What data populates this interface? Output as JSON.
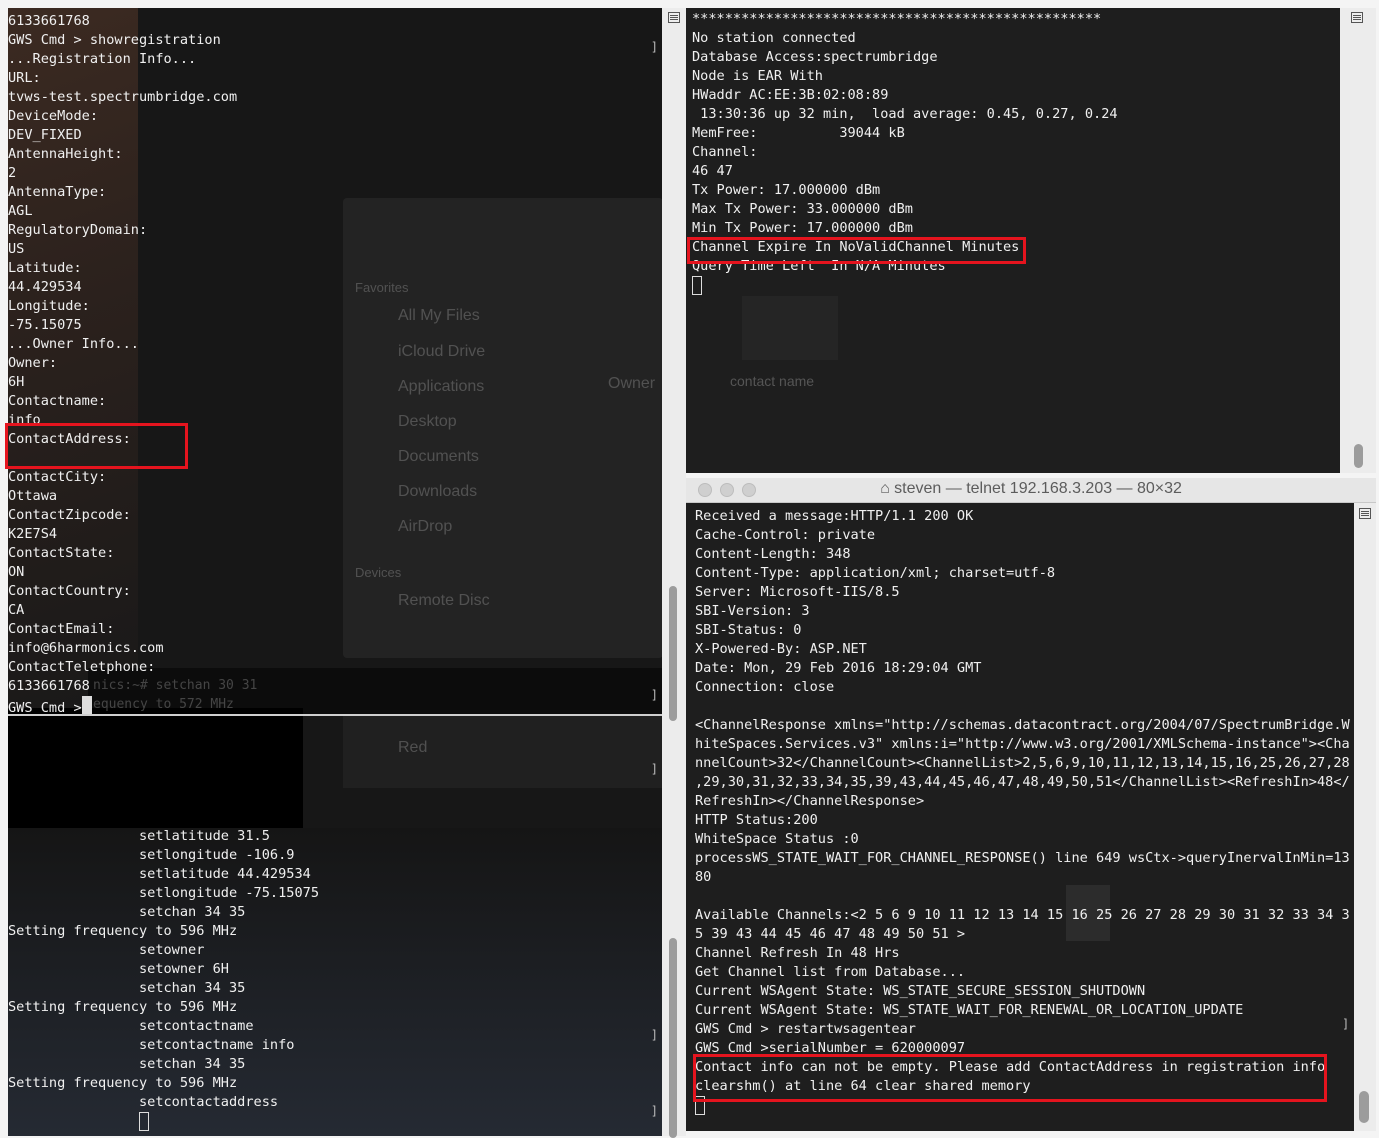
{
  "left_terminal": {
    "lines": [
      "6133661768",
      "GWS Cmd > showregistration",
      "...Registration Info...",
      "URL:",
      "tvws-test.spectrumbridge.com",
      "DeviceMode:",
      "DEV_FIXED",
      "AntennaHeight:",
      "2",
      "AntennaType:",
      "AGL",
      "RegulatoryDomain:",
      "US",
      "Latitude:",
      "44.429534",
      "Longitude:",
      "-75.15075",
      "...Owner Info...",
      "Owner:",
      "6H",
      "Contactname:",
      "info",
      "ContactAddress:",
      "",
      "ContactCity:",
      "Ottawa",
      "ContactZipcode:",
      "K2E7S4",
      "ContactState:",
      "ON",
      "ContactCountry:",
      "CA",
      "ContactEmail:",
      "info@6harmonics.com",
      "ContactTeletphone:",
      "6133661768",
      "GWS Cmd >"
    ],
    "ghost_text": {
      "favorites": "Favorites",
      "all_my_files": "All My Files",
      "icloud_drive": "iCloud Drive",
      "applications": "Applications",
      "desktop": "Desktop",
      "documents": "Documents",
      "downloads": "Downloads",
      "airdrop": "AirDrop",
      "devices": "Devices",
      "remote_disc": "Remote Disc",
      "owner": "Owner",
      "red": "Red",
      "setchan": "nics:~# setchan 30 31",
      "frequency": "equency to 572 MHz"
    },
    "lower_lines": [
      "                setlatitude 31.5",
      "                setlongitude -106.9",
      "                setlatitude 44.429534",
      "                setlongitude -75.15075",
      "                setchan 34 35",
      "Setting frequency to 596 MHz",
      "                setowner",
      "                setowner 6H",
      "                setchan 34 35",
      "Setting frequency to 596 MHz",
      "                setcontactname",
      "                setcontactname info",
      "                setchan 34 35",
      "Setting frequency to 596 MHz",
      "                setcontactaddress"
    ]
  },
  "right_top_terminal": {
    "lines": [
      "**************************************************",
      "No station connected",
      "Database Access:spectrumbridge",
      "Node is EAR With",
      "HWaddr AC:EE:3B:02:08:89",
      " 13:30:36 up 32 min,  load average: 0.45, 0.27, 0.24",
      "MemFree:          39044 kB",
      "Channel:",
      "46 47",
      "Tx Power: 17.000000 dBm",
      "Max Tx Power: 33.000000 dBm",
      "Min Tx Power: 17.000000 dBm",
      "Channel Expire In NoValidChannel Minutes",
      "Query Time Left  In N/A Minutes"
    ],
    "ghost_contact": "contact name"
  },
  "right_bottom_window": {
    "title": "steven — telnet 192.168.3.203 — 80×32",
    "lines": [
      "Received a message:HTTP/1.1 200 OK",
      "Cache-Control: private",
      "Content-Length: 348",
      "Content-Type: application/xml; charset=utf-8",
      "Server: Microsoft-IIS/8.5",
      "SBI-Version: 3",
      "SBI-Status: 0",
      "X-Powered-By: ASP.NET",
      "Date: Mon, 29 Feb 2016 18:29:04 GMT",
      "Connection: close",
      "",
      "<ChannelResponse xmlns=\"http://schemas.datacontract.org/2004/07/SpectrumBridge.W",
      "hiteSpaces.Services.v3\" xmlns:i=\"http://www.w3.org/2001/XMLSchema-instance\"><Cha",
      "nnelCount>32</ChannelCount><ChannelList>2,5,6,9,10,11,12,13,14,15,16,25,26,27,28",
      ",29,30,31,32,33,34,35,39,43,44,45,46,47,48,49,50,51</ChannelList><RefreshIn>48</",
      "RefreshIn></ChannelResponse>",
      "HTTP Status:200",
      "WhiteSpace Status :0",
      "processWS_STATE_WAIT_FOR_CHANNEL_RESPONSE() line 649 wsCtx->queryInervalInMin=13",
      "80",
      "",
      "Available Channels:<2 5 6 9 10 11 12 13 14 15 16 25 26 27 28 29 30 31 32 33 34 3",
      "5 39 43 44 45 46 47 48 49 50 51 >",
      "Channel Refresh In 48 Hrs",
      "Get Channel list from Database...",
      "Current WSAgent State: WS_STATE_SECURE_SESSION_SHUTDOWN",
      "Current WSAgent State: WS_STATE_WAIT_FOR_RENEWAL_OR_LOCATION_UPDATE",
      "GWS Cmd > restartwsagentear",
      "GWS Cmd >serialNumber = 620000097",
      "Contact info can not be empty. Please add ContactAddress in registration info",
      "clearshm() at line 64 clear shared memory"
    ]
  },
  "colors": {
    "highlight_box": "#e5141e",
    "terminal_bg": "#1e1e1e",
    "terminal_text": "#f0f0f0"
  }
}
